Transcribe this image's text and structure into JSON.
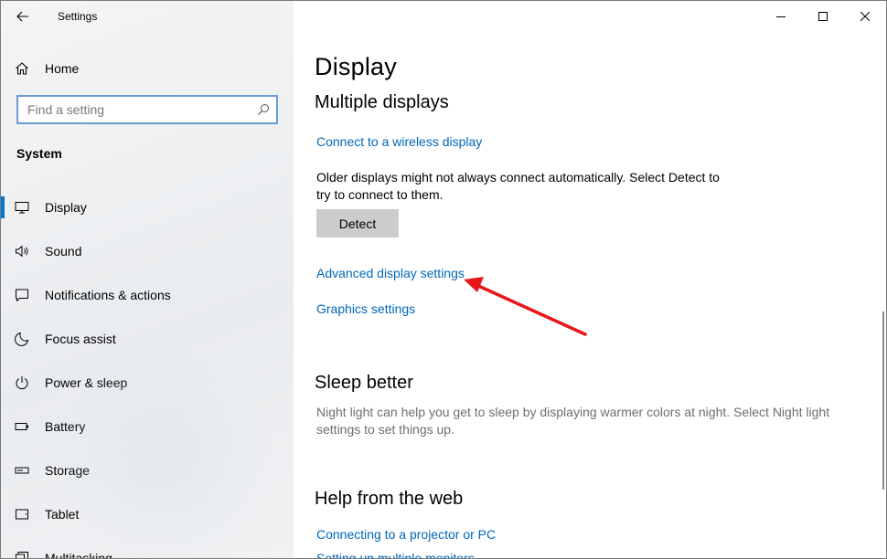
{
  "window": {
    "title": "Settings"
  },
  "sidebar": {
    "home_label": "Home",
    "search": {
      "placeholder": "Find a setting",
      "value": ""
    },
    "section_label": "System",
    "items": [
      {
        "label": "Display",
        "icon": "monitor-icon",
        "selected": true
      },
      {
        "label": "Sound",
        "icon": "speaker-icon",
        "selected": false
      },
      {
        "label": "Notifications & actions",
        "icon": "notification-icon",
        "selected": false
      },
      {
        "label": "Focus assist",
        "icon": "moon-icon",
        "selected": false
      },
      {
        "label": "Power & sleep",
        "icon": "power-icon",
        "selected": false
      },
      {
        "label": "Battery",
        "icon": "battery-icon",
        "selected": false
      },
      {
        "label": "Storage",
        "icon": "storage-icon",
        "selected": false
      },
      {
        "label": "Tablet",
        "icon": "tablet-icon",
        "selected": false
      },
      {
        "label": "Multitasking",
        "icon": "multitasking-icon",
        "selected": false
      }
    ]
  },
  "main": {
    "page_title": "Display",
    "multiple_displays": {
      "heading": "Multiple displays",
      "wireless_link": "Connect to a wireless display",
      "description": "Older displays might not always connect automatically. Select Detect to try to connect to them.",
      "detect_button": "Detect",
      "advanced_link": "Advanced display settings",
      "graphics_link": "Graphics settings"
    },
    "sleep_better": {
      "heading": "Sleep better",
      "description": "Night light can help you get to sleep by displaying warmer colors at night. Select Night light settings to set things up."
    },
    "help": {
      "heading": "Help from the web",
      "links": [
        "Connecting to a projector or PC",
        "Setting up multiple monitors"
      ]
    }
  },
  "colors": {
    "accent": "#0078d4",
    "link": "#0067b8",
    "annotation_arrow": "#e8161b"
  }
}
